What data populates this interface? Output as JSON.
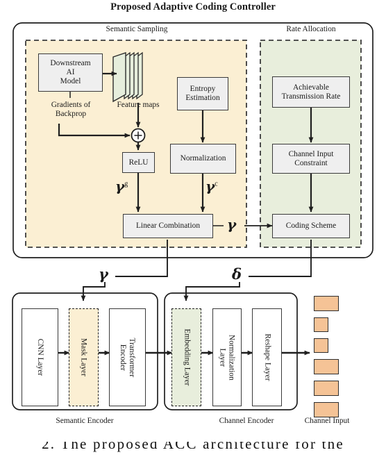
{
  "title": "Proposed Adaptive Coding Controller",
  "colors": {
    "semantic_sampling_fill": "#FBEFD3",
    "rate_allocation_fill": "#E8EEDC",
    "box_fill": "#EFEFEF",
    "channel_input_fill": "#F5C396",
    "stroke": "#3a3a3a",
    "feature_map_fill": "#E6EEDC"
  },
  "sections": {
    "semantic_sampling_label": "Semantic Sampling",
    "rate_allocation_label": "Rate Allocation"
  },
  "controller": {
    "boxes": {
      "downstream_ai_model": "Downstream\nAI\nModel",
      "entropy_estimation": "Entropy\nEstimation",
      "relu": "ReLU",
      "normalization": "Normalization",
      "linear_combination": "Linear Combination",
      "achievable_rate": "Achievable\nTransmission Rate",
      "channel_input_constraint": "Channel Input\nConstraint",
      "coding_scheme": "Coding Scheme"
    },
    "labels": {
      "gradients_of_backprop": "Gradients of\nBackprop",
      "feature_maps": "Feature maps",
      "adder": "+"
    },
    "symbols": {
      "gamma_g": "γ",
      "gamma_g_sup": "g",
      "gamma_c": "γ",
      "gamma_c_sup": "c",
      "gamma": "γ"
    }
  },
  "pipeline": {
    "routing": {
      "gamma": "γ",
      "delta": "δ"
    },
    "semantic_encoder": {
      "group_label": "Semantic Encoder",
      "stages": [
        {
          "name": "cnn-layer",
          "label": "CNN Layer",
          "style": "solid"
        },
        {
          "name": "mask-layer",
          "label": "Mask Layer",
          "style": "dashed-yellow"
        },
        {
          "name": "transformer-encoder",
          "label": "Transformer\nEncoder",
          "style": "solid"
        }
      ]
    },
    "channel_encoder": {
      "group_label": "Channel Encoder",
      "stages": [
        {
          "name": "embedding-layer",
          "label": "Embedding Layer",
          "style": "dashed-green"
        },
        {
          "name": "normalization-layer",
          "label": "Normalization\nLayer",
          "style": "solid"
        },
        {
          "name": "reshape-layer",
          "label": "Reshape Layer",
          "style": "solid"
        }
      ]
    },
    "channel_input": {
      "label": "Channel Input",
      "blocks": [
        {
          "width": 36,
          "height": 22
        },
        {
          "width": 21,
          "height": 21
        },
        {
          "width": 21,
          "height": 21
        },
        {
          "width": 36,
          "height": 22
        },
        {
          "width": 36,
          "height": 22
        },
        {
          "width": 36,
          "height": 22
        }
      ]
    }
  },
  "caption_fragment": "2.  The proposed ACC architecture for the"
}
